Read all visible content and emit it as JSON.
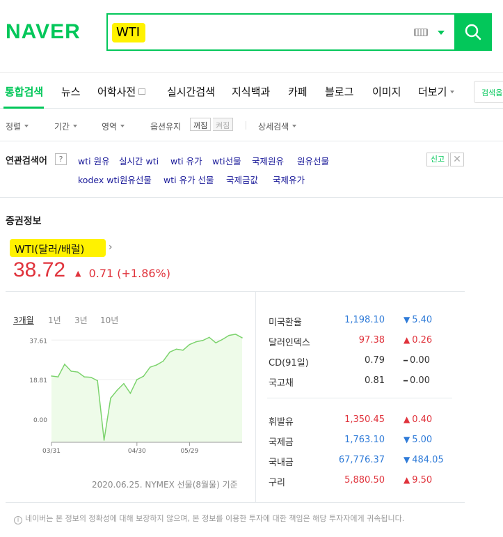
{
  "header": {
    "logo": "NAVER",
    "query": "WTI"
  },
  "tabs": [
    {
      "label": "통합검색",
      "active": true
    },
    {
      "label": "뉴스"
    },
    {
      "label": "어학사전"
    },
    {
      "label": "실시간검색"
    },
    {
      "label": "지식백과"
    },
    {
      "label": "카페"
    },
    {
      "label": "블로그"
    },
    {
      "label": "이미지"
    },
    {
      "label": "더보기"
    }
  ],
  "option_button": "검색옵",
  "filters": {
    "sort": "정렬",
    "period": "기간",
    "area": "영역",
    "keep_option": "옵션유지",
    "off": "꺼짐",
    "on": "켜짐",
    "detail": "상세검색"
  },
  "related": {
    "title": "연관검색어",
    "help": "?",
    "keywords": [
      "wti 원유",
      "실시간 wti",
      "wti 유가",
      "wti선물",
      "국제원유",
      "원유선물",
      "kodex wti원유선물",
      "wti 유가 선물",
      "국제금값",
      "국제유가"
    ],
    "report": "신고",
    "close": "✕"
  },
  "stock": {
    "section_title": "증권정보",
    "name": "WTI(달러/배럴)",
    "name_arrow": "›",
    "price": "38.72",
    "change": "0.71",
    "change_pct": "(+1.86%)",
    "up_arrow": "▲",
    "periods": [
      "3개월",
      "1년",
      "3년",
      "10년"
    ],
    "caption": "2020.06.25. NYMEX 선물(8월물) 기준"
  },
  "indicators": [
    {
      "name": "미국환율",
      "value": "1,198.10",
      "value_color": "down",
      "arrow": "▼",
      "change": "5.40",
      "dir": "down"
    },
    {
      "name": "달러인덱스",
      "value": "97.38",
      "value_color": "up",
      "arrow": "▲",
      "change": "0.26",
      "dir": "up"
    },
    {
      "name": "CD(91일)",
      "value": "0.79",
      "value_color": "flat",
      "arrow": "━",
      "change": "0.00",
      "dir": "flat"
    },
    {
      "name": "국고채",
      "value": "0.81",
      "value_color": "flat",
      "arrow": "━",
      "change": "0.00",
      "dir": "flat"
    },
    {
      "name": "휘발유",
      "value": "1,350.45",
      "value_color": "up",
      "arrow": "▲",
      "change": "0.40",
      "dir": "up"
    },
    {
      "name": "국제금",
      "value": "1,763.10",
      "value_color": "down",
      "arrow": "▼",
      "change": "5.00",
      "dir": "down"
    },
    {
      "name": "국내금",
      "value": "67,776.37",
      "value_color": "down",
      "arrow": "▼",
      "change": "484.05",
      "dir": "down"
    },
    {
      "name": "구리",
      "value": "5,880.50",
      "value_color": "up",
      "arrow": "▲",
      "change": "9.50",
      "dir": "up"
    }
  ],
  "chart_data": {
    "type": "area",
    "y_ticks": [
      "37.61",
      "18.81",
      "0.00"
    ],
    "ylim": [
      -11,
      42
    ],
    "x_ticks": [
      "03/31",
      "04/30",
      "05/29"
    ],
    "x": [
      "03/31",
      "04/02",
      "04/06",
      "04/08",
      "04/10",
      "04/14",
      "04/16",
      "04/17",
      "04/20",
      "04/21",
      "04/22",
      "04/24",
      "04/28",
      "04/30",
      "05/04",
      "05/08",
      "05/12",
      "05/15",
      "05/19",
      "05/22",
      "05/27",
      "05/29",
      "06/02",
      "06/05",
      "06/09",
      "06/12",
      "06/16",
      "06/19",
      "06/23",
      "06/25"
    ],
    "values": [
      20.5,
      20.1,
      26.1,
      22.8,
      22.4,
      20.1,
      19.9,
      18.3,
      -10.0,
      10.0,
      13.8,
      16.9,
      12.3,
      18.8,
      20.4,
      24.7,
      25.8,
      27.6,
      31.9,
      33.3,
      32.8,
      35.5,
      36.8,
      37.4,
      38.9,
      36.3,
      37.9,
      39.8,
      40.4,
      38.7
    ],
    "color": "#7cd36d"
  },
  "disclaimer": "네이버는 본 정보의 정확성에 대해 보장하지 않으며, 본 정보를 이용한 투자에 대한 책임은 해당 투자자에게 귀속됩니다."
}
